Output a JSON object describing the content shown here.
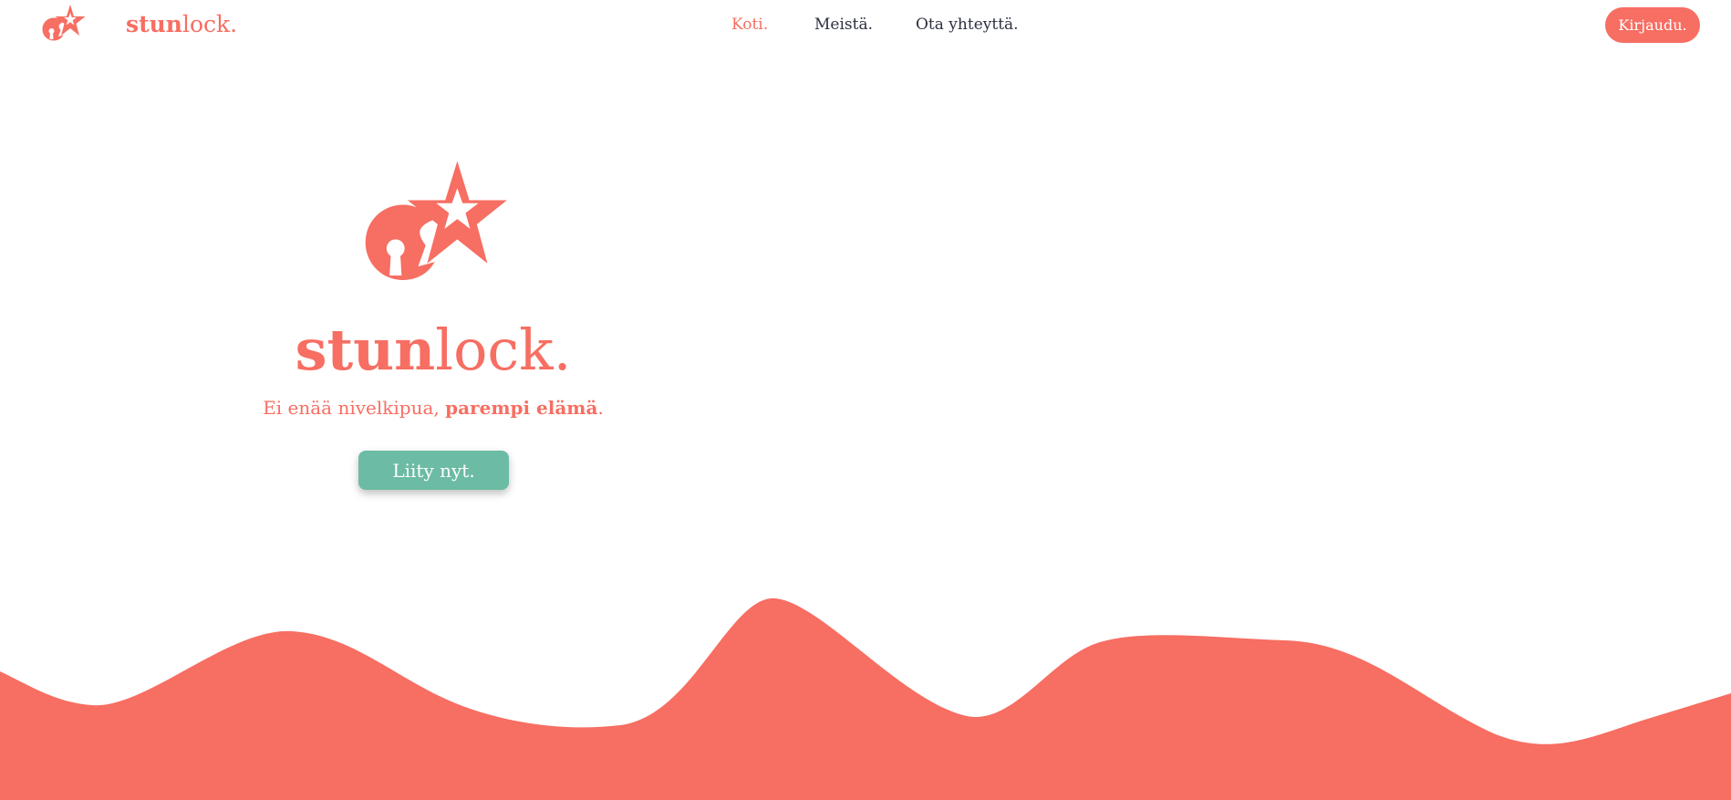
{
  "nav": {
    "brand_bold": "stun",
    "brand_light": "lock.",
    "links": [
      {
        "label": "Koti.",
        "active": true
      },
      {
        "label": "Meistä.",
        "active": false
      },
      {
        "label": "Ota yhteyttä.",
        "active": false
      }
    ],
    "login_label": "Kirjaudu."
  },
  "hero": {
    "brand_bold": "stun",
    "brand_light": "lock.",
    "tagline_start": "Ei enää nivelkipua, ",
    "tagline_bold": "parempi elämä",
    "tagline_end": ".",
    "join_label": "Liity nyt."
  },
  "icons": {
    "logo": "lock-star-logo-icon"
  },
  "colors": {
    "brand": "#f76e62",
    "accent": "#6cbba4",
    "nav_text": "#2d3040",
    "background": "#ffffff"
  }
}
